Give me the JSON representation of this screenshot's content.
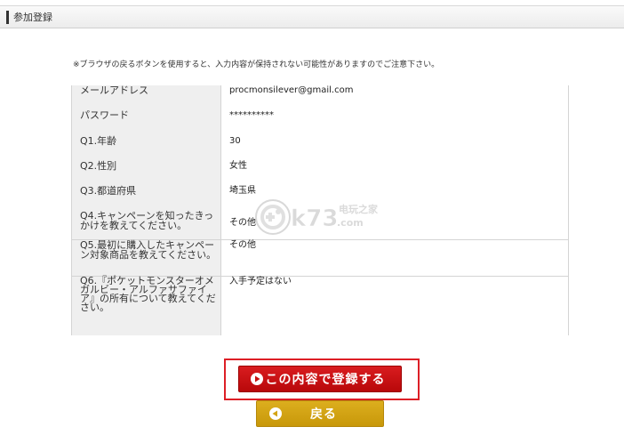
{
  "header": {
    "title": "参加登録"
  },
  "notice": "※ブラウザの戻るボタンを使用すると、入力内容が保持されない可能性がありますのでご注意下さい。",
  "form": {
    "rows": [
      {
        "label": "メールアドレス",
        "value": "procmonsilever@gmail.com"
      },
      {
        "label": "パスワード",
        "value": "**********"
      },
      {
        "label": "Q1.年齢",
        "value": "30"
      },
      {
        "label": "Q2.性別",
        "value": "女性"
      },
      {
        "label": "Q3.都道府県",
        "value": "埼玉県"
      },
      {
        "label": "Q4.キャンペーンを知ったきっかけを教えてください。",
        "value": "その他"
      },
      {
        "label": "Q5.最初に購入したキャンペーン対象商品を教えてください。",
        "value": "その他"
      },
      {
        "label": "Q6.『ポケットモンスターオメガルビー・アルファサファイア』の所有について教えてください。",
        "value": "入手予定はない"
      }
    ]
  },
  "watermark": {
    "text": "k73",
    "subtext": "电玩之家",
    "domain": ".com"
  },
  "buttons": {
    "submit_label": "この内容で登録する",
    "back_label": "戻る",
    "submit_icon": "play-circle-icon",
    "back_icon": "back-circle-icon"
  },
  "colors": {
    "submit": "#c8100f",
    "submit_frame": "#dd1f26",
    "back": "#d4a414",
    "label_bg": "#efefef"
  }
}
